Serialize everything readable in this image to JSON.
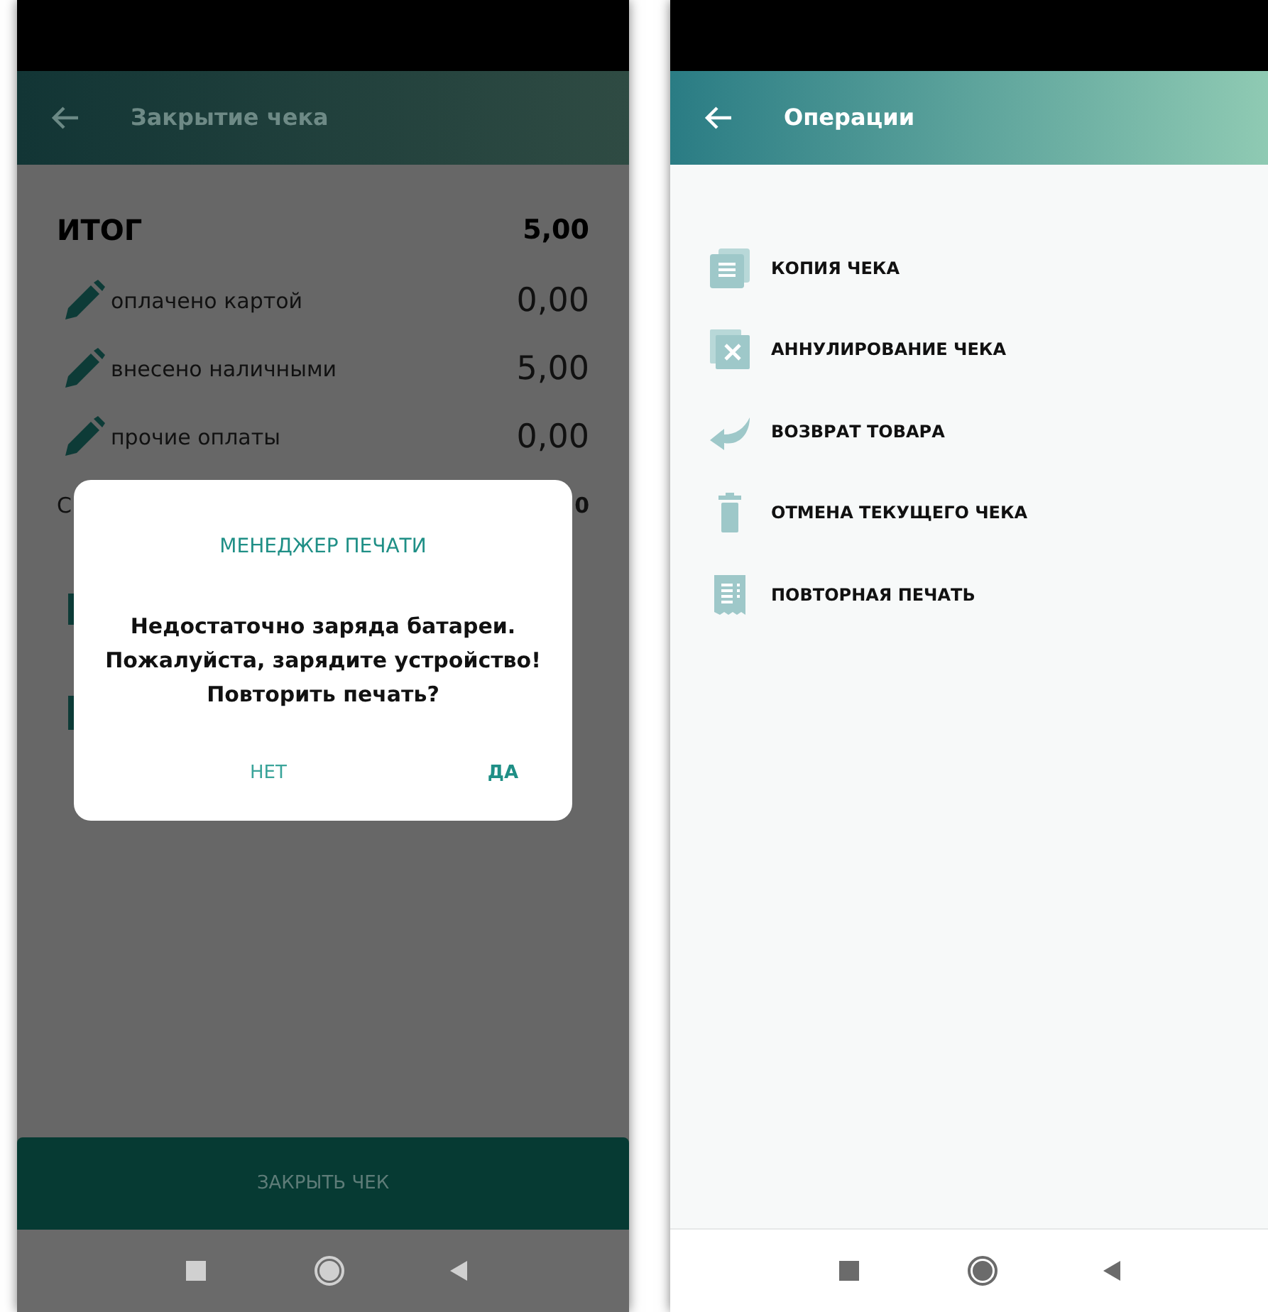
{
  "left_screen": {
    "header": {
      "title": "Закрытие чека"
    },
    "total": {
      "label": "ИТОГ",
      "value": "5,00"
    },
    "payments": [
      {
        "label": "оплачено картой",
        "value": "0,00"
      },
      {
        "label": "внесено наличными",
        "value": "5,00"
      },
      {
        "label": "прочие оплаты",
        "value": "0,00"
      }
    ],
    "covered_row": {
      "label": "С",
      "value": "0"
    },
    "close_button": "ЗАКРЫТЬ ЧЕК",
    "dialog": {
      "title": "МЕНЕДЖЕР ПЕЧАТИ",
      "message": "Недостаточно заряда батареи.\nПожалуйста, зарядите устройство!\nПовторить печать?",
      "buttons": [
        {
          "label": "НЕТ",
          "kind": "secondary"
        },
        {
          "label": "ДА",
          "kind": "primary"
        }
      ]
    }
  },
  "right_screen": {
    "header": {
      "title": "Операции"
    },
    "operations": [
      {
        "label": "КОПИЯ ЧЕКА",
        "kind": "copy"
      },
      {
        "label": "АННУЛИРОВАНИЕ ЧЕКА",
        "kind": "void"
      },
      {
        "label": "ВОЗВРАТ ТОВАРА",
        "kind": "return"
      },
      {
        "label": "ОТМЕНА ТЕКУЩЕГО ЧЕКА",
        "kind": "delete"
      },
      {
        "label": "ПОВТОРНАЯ ПЕЧАТЬ",
        "kind": "reprint"
      }
    ]
  }
}
